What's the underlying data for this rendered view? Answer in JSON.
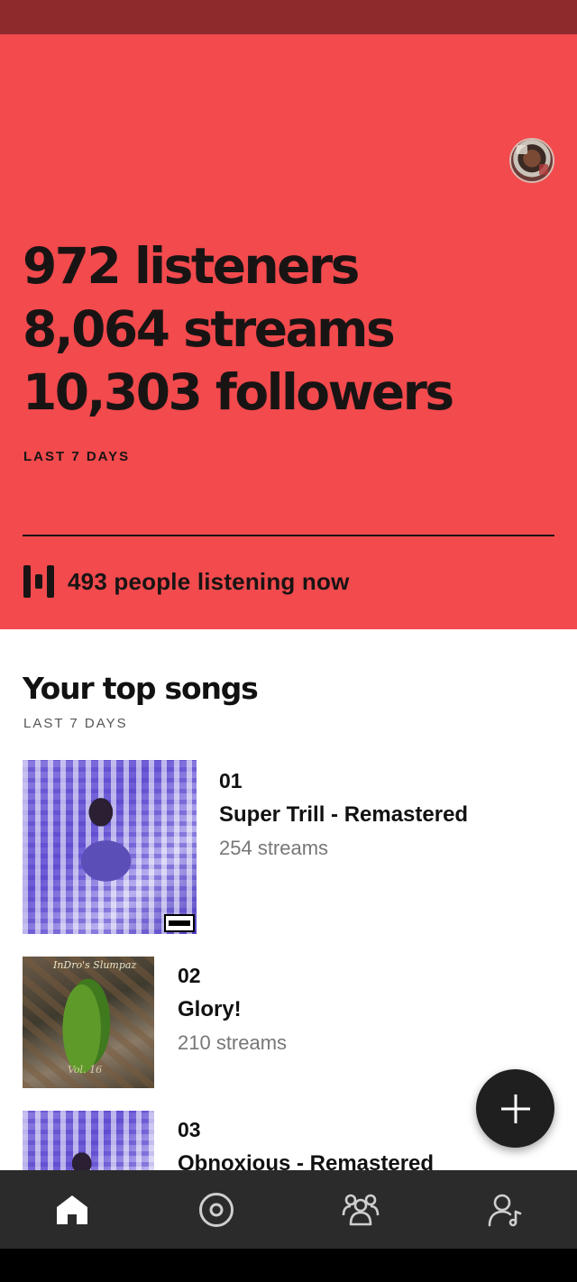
{
  "hero": {
    "stats": [
      {
        "text": "972 listeners"
      },
      {
        "text": "8,064 streams"
      },
      {
        "text": "10,303 followers"
      }
    ],
    "period": "LAST 7 DAYS",
    "listening_now": "493 people listening now",
    "background_color": "#f24a4d"
  },
  "top_songs": {
    "title": "Your top songs",
    "period": "LAST 7 DAYS",
    "songs": [
      {
        "rank": "01",
        "title": "Super Trill - Remastered",
        "streams": "254 streams"
      },
      {
        "rank": "02",
        "title": "Glory!",
        "streams": "210 streams",
        "art_text": "InDro's Slumpaz",
        "art_vol": "Vol. 16"
      },
      {
        "rank": "03",
        "title": "Obnoxious - Remastered",
        "streams": ""
      }
    ]
  },
  "fab": {
    "icon": "plus-icon"
  },
  "bottom_nav": {
    "items": [
      {
        "icon": "home-icon",
        "active": true
      },
      {
        "icon": "music-disc-icon",
        "active": false
      },
      {
        "icon": "audience-icon",
        "active": false
      },
      {
        "icon": "profile-icon",
        "active": false
      }
    ]
  }
}
